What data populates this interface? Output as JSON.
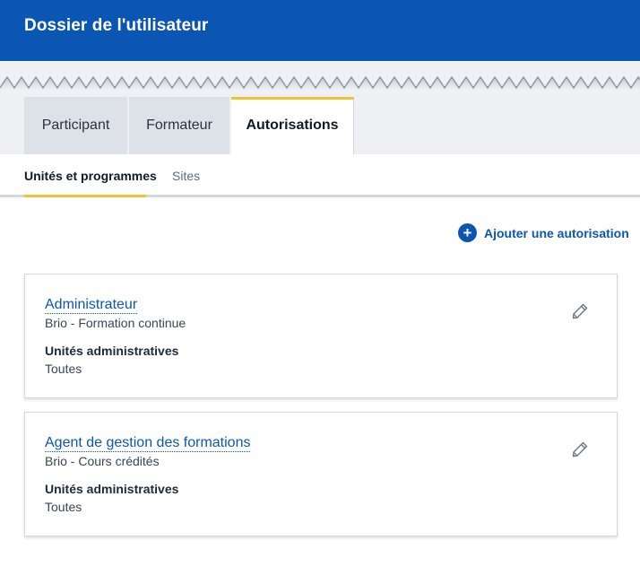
{
  "header": {
    "title": "Dossier de l'utilisateur"
  },
  "tabs": [
    {
      "label": "Participant",
      "active": false
    },
    {
      "label": "Formateur",
      "active": false
    },
    {
      "label": "Autorisations",
      "active": true
    }
  ],
  "subtabs": [
    {
      "label": "Unités et programmes",
      "active": true
    },
    {
      "label": "Sites",
      "active": false
    }
  ],
  "add_button": {
    "icon": "plus-icon",
    "label": "Ajouter une autorisation"
  },
  "authorizations": [
    {
      "title": "Administrateur",
      "program": "Brio - Formation continue",
      "units_label": "Unités administratives",
      "units_value": "Toutes",
      "icon": "pencil-icon"
    },
    {
      "title": "Agent de gestion des formations",
      "program": "Brio - Cours crédités",
      "units_label": "Unités administratives",
      "units_value": "Toutes",
      "icon": "pencil-icon"
    }
  ],
  "colors": {
    "primary": "#0b56b3",
    "accent": "#f2c230",
    "tab_bg": "#dde1e8",
    "band_bg": "#eef0f4"
  }
}
